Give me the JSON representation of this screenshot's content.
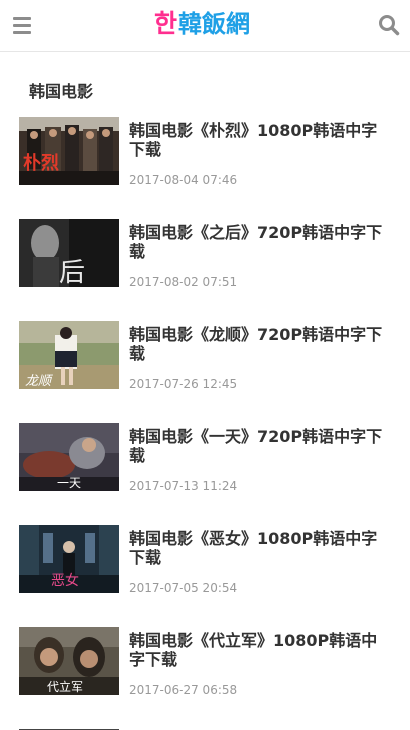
{
  "header": {
    "logo_mark": "한",
    "logo_text": "韓飯網",
    "menu_icon": "hamburger-menu-icon",
    "search_icon": "search-icon"
  },
  "section": {
    "title": "韩国电影"
  },
  "articles": [
    {
      "title": "韩国电影《朴烈》1080P韩语中字下载",
      "date": "2017-08-04 07:46",
      "thumb_overlay": "朴烈"
    },
    {
      "title": "韩国电影《之后》720P韩语中字下载",
      "date": "2017-08-02 07:51",
      "thumb_overlay": "后"
    },
    {
      "title": "韩国电影《龙顺》720P韩语中字下载",
      "date": "2017-07-26 12:45",
      "thumb_overlay": "龙顺"
    },
    {
      "title": "韩国电影《一天》720P韩语中字下载",
      "date": "2017-07-13 11:24",
      "thumb_overlay": "一天"
    },
    {
      "title": "韩国电影《恶女》1080P韩语中字下载",
      "date": "2017-07-05 20:54",
      "thumb_overlay": "恶女"
    },
    {
      "title": "韩国电影《代立军》1080P韩语中字下载",
      "date": "2017-06-27 06:58",
      "thumb_overlay": "代立军"
    }
  ]
}
